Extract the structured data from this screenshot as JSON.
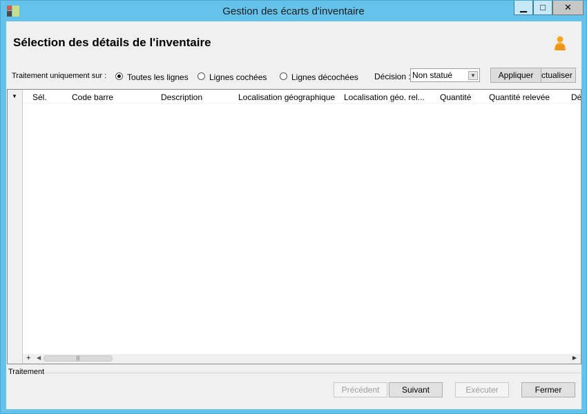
{
  "window": {
    "title": "Gestion des écarts d'inventaire",
    "minimize_glyph": "▁",
    "maximize_glyph": "□",
    "close_glyph": "✕"
  },
  "header": {
    "title": "Sélection des détails de l'inventaire",
    "user_icon": "user-icon"
  },
  "filters": {
    "label": "Traitement uniquement sur :",
    "options": [
      "Toutes les lignes",
      "Lignes cochées",
      "Lignes décochées"
    ],
    "selected": "Toutes les lignes",
    "decision_label": "Décision :",
    "decision_value": "Non statué",
    "apply_label": "Appliquer",
    "refresh_label": "ctualiser"
  },
  "grid": {
    "menu_glyph": "▼",
    "columns": [
      "Sél.",
      "Code barre",
      "Description",
      "Localisation géographique",
      "Localisation géo. rel...",
      "Quantité",
      "Quantité relevée",
      "Dé"
    ],
    "rows": [],
    "add_glyph": "+",
    "scroll_left_glyph": "◀",
    "scroll_right_glyph": "▶",
    "thumb_grip": "|||"
  },
  "footer": {
    "group_label": "Traitement",
    "prev_label": "Précédent",
    "next_label": "Suivant",
    "exec_label": "Exécuter",
    "close_label": "Fermer"
  },
  "colors": {
    "frame": "#65c3eb",
    "client": "#f0f0f0",
    "icon_orange": "#f5a623"
  }
}
